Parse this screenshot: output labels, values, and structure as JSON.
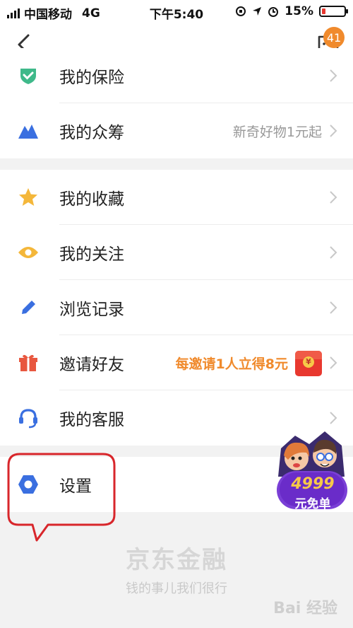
{
  "status_bar": {
    "carrier": "中国移动",
    "network": "4G",
    "time": "下午5:40",
    "battery_pct": "15%",
    "battery_level": 0.15
  },
  "nav": {
    "message_badge": "41"
  },
  "group1": [
    {
      "label": "我的保险",
      "hint": "",
      "icon": "shield-check-icon"
    },
    {
      "label": "我的众筹",
      "hint": "新奇好物1元起",
      "icon": "mountain-icon"
    }
  ],
  "group2": [
    {
      "label": "我的收藏",
      "hint": "",
      "icon": "star-icon"
    },
    {
      "label": "我的关注",
      "hint": "",
      "icon": "eye-icon"
    },
    {
      "label": "浏览记录",
      "hint": "",
      "icon": "pencil-icon"
    },
    {
      "label": "邀请好友",
      "hint": "每邀请1人立得8元",
      "icon": "gift-icon"
    },
    {
      "label": "我的客服",
      "hint": "",
      "icon": "headset-icon"
    }
  ],
  "group3": [
    {
      "label": "设置",
      "hint": "",
      "icon": "settings-hex-icon"
    }
  ],
  "redpack_symbol": "¥",
  "promo": {
    "amount": "4999",
    "text": "元免单"
  },
  "footer": {
    "brand": "京东金融",
    "slogan": "钱的事儿我们很行"
  },
  "watermark": "Bai 经验",
  "colors": {
    "accent_orange": "#f08a2c",
    "red": "#e8382f",
    "blue": "#3a6fe0",
    "green": "#3fb98a",
    "yellow": "#f4b73a"
  }
}
